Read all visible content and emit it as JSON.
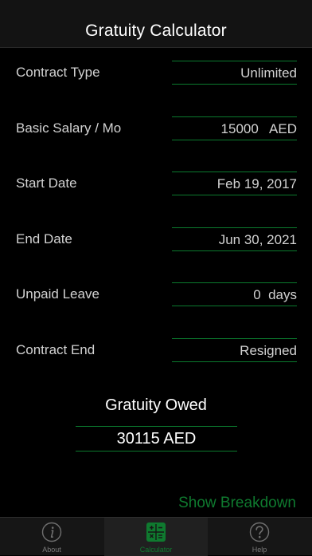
{
  "header": {
    "title": "Gratuity Calculator"
  },
  "fields": [
    {
      "label": "Contract Type",
      "value": "Unlimited"
    },
    {
      "label": "Basic Salary / Mo",
      "value": "15000   AED"
    },
    {
      "label": "Start Date",
      "value": "Feb 19, 2017"
    },
    {
      "label": "End Date",
      "value": "Jun 30, 2021"
    },
    {
      "label": "Unpaid Leave",
      "value": "0  days"
    },
    {
      "label": "Contract End",
      "value": "Resigned"
    }
  ],
  "result": {
    "title": "Gratuity Owed",
    "value": "30115 AED"
  },
  "breakdown_link": "Show Breakdown",
  "tabs": [
    {
      "label": "About",
      "icon": "info-icon",
      "active": false
    },
    {
      "label": "Calculator",
      "icon": "calculator-icon",
      "active": true
    },
    {
      "label": "Help",
      "icon": "help-icon",
      "active": false
    }
  ],
  "colors": {
    "accent": "#0f7a2f",
    "background": "#000000",
    "text": "#d2d2d2"
  }
}
